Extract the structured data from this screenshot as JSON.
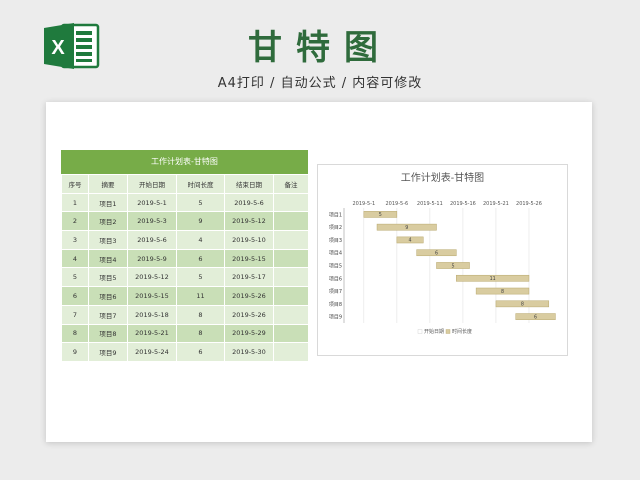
{
  "header": {
    "title": "甘特图",
    "subtitle": "A4打印 / 自动公式 / 内容可修改",
    "logo_letter": "X"
  },
  "colors": {
    "excel_green": "#1f7a3d",
    "title_green": "#2f6b3c",
    "table_header": "#77ac48",
    "row_light": "#e2eed8",
    "row_dark": "#c9dfb7",
    "bar_fill": "#d9cca0",
    "bar_stroke": "#b8a76c"
  },
  "table": {
    "title": "工作计划表-甘特图",
    "columns": [
      "序号",
      "摘要",
      "开始日期",
      "时间长度",
      "结束日期",
      "备注"
    ],
    "rows": [
      [
        "1",
        "项目1",
        "2019-5-1",
        "5",
        "2019-5-6",
        ""
      ],
      [
        "2",
        "项目2",
        "2019-5-3",
        "9",
        "2019-5-12",
        ""
      ],
      [
        "3",
        "项目3",
        "2019-5-6",
        "4",
        "2019-5-10",
        ""
      ],
      [
        "4",
        "项目4",
        "2019-5-9",
        "6",
        "2019-5-15",
        ""
      ],
      [
        "5",
        "项目5",
        "2019-5-12",
        "5",
        "2019-5-17",
        ""
      ],
      [
        "6",
        "项目6",
        "2019-5-15",
        "11",
        "2019-5-26",
        ""
      ],
      [
        "7",
        "项目7",
        "2019-5-18",
        "8",
        "2019-5-26",
        ""
      ],
      [
        "8",
        "项目8",
        "2019-5-21",
        "8",
        "2019-5-29",
        ""
      ],
      [
        "9",
        "项目9",
        "2019-5-24",
        "6",
        "2019-5-30",
        ""
      ]
    ]
  },
  "chart_data": {
    "type": "bar",
    "orientation": "horizontal-stacked-gantt",
    "title": "工作计划表-甘特图",
    "categories": [
      "项目1",
      "项目2",
      "项目3",
      "项目4",
      "项目5",
      "项目6",
      "项目7",
      "项目8",
      "项目9"
    ],
    "start_dates": [
      "2019-5-1",
      "2019-5-3",
      "2019-5-6",
      "2019-5-9",
      "2019-5-12",
      "2019-5-15",
      "2019-5-18",
      "2019-5-21",
      "2019-5-24"
    ],
    "series": [
      {
        "name": "开始日期",
        "values": [
          "2019-5-1",
          "2019-5-3",
          "2019-5-6",
          "2019-5-9",
          "2019-5-12",
          "2019-5-15",
          "2019-5-18",
          "2019-5-21",
          "2019-5-24"
        ],
        "visible": false
      },
      {
        "name": "时间长度",
        "values": [
          5,
          9,
          4,
          6,
          5,
          11,
          8,
          8,
          6
        ]
      }
    ],
    "x_ticks": [
      "2019-5-1",
      "2019-5-6",
      "2019-5-11",
      "2019-5-16",
      "2019-5-21",
      "2019-5-26"
    ],
    "xlim": [
      "2019-4-28",
      "2019-5-31"
    ],
    "grid": true,
    "legend_position": "bottom",
    "legend": [
      "开始日期",
      "时间长度"
    ]
  }
}
